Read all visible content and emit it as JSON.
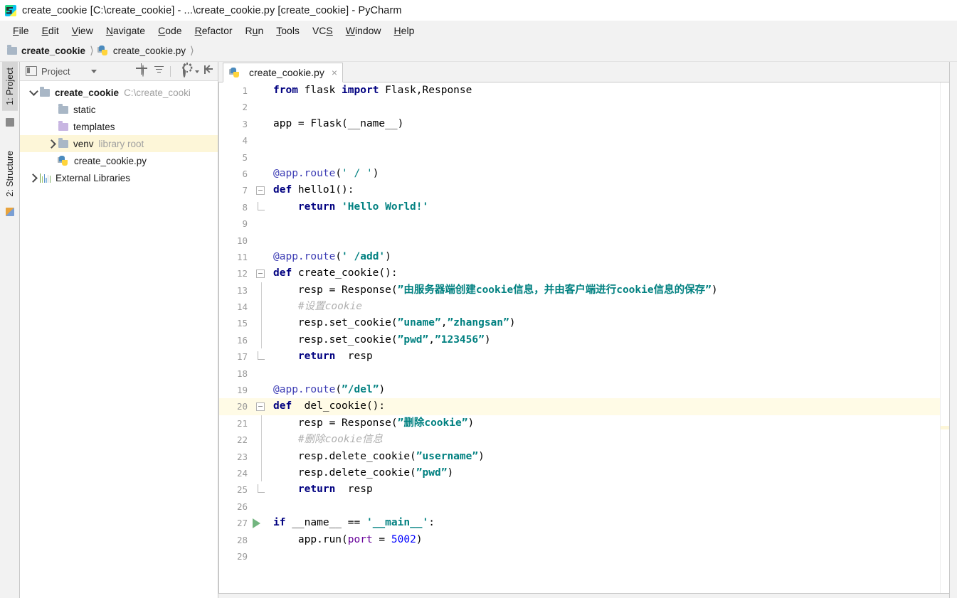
{
  "window": {
    "title": "create_cookie [C:\\create_cookie] - ...\\create_cookie.py [create_cookie] - PyCharm",
    "app_icon": "pycharm-icon"
  },
  "menubar": {
    "items": [
      {
        "label": "File",
        "mnemonic": "F"
      },
      {
        "label": "Edit",
        "mnemonic": "E"
      },
      {
        "label": "View",
        "mnemonic": "V"
      },
      {
        "label": "Navigate",
        "mnemonic": "N"
      },
      {
        "label": "Code",
        "mnemonic": "C"
      },
      {
        "label": "Refactor",
        "mnemonic": "R"
      },
      {
        "label": "Run",
        "mnemonic": "u"
      },
      {
        "label": "Tools",
        "mnemonic": "T"
      },
      {
        "label": "VCS",
        "mnemonic": "S"
      },
      {
        "label": "Window",
        "mnemonic": "W"
      },
      {
        "label": "Help",
        "mnemonic": "H"
      }
    ]
  },
  "breadcrumb": {
    "items": [
      {
        "label": "create_cookie",
        "icon": "folder-icon",
        "bold": true
      },
      {
        "label": "create_cookie.py",
        "icon": "python-file-icon",
        "bold": false
      }
    ]
  },
  "tool_windows": {
    "left_tabs": [
      {
        "label": "1: Project",
        "active": true,
        "icon": "project-icon"
      },
      {
        "label": "2: Structure",
        "active": false,
        "icon": "structure-icon"
      }
    ]
  },
  "project_panel": {
    "title": "Project",
    "toolbar_icons": [
      {
        "name": "locate-icon",
        "title": "Select Opened File"
      },
      {
        "name": "collapse-all-icon",
        "title": "Collapse All"
      },
      {
        "name": "gear-icon",
        "title": "Settings"
      },
      {
        "name": "hide-icon",
        "title": "Hide"
      }
    ],
    "tree": [
      {
        "label": "create_cookie",
        "sub": "C:\\create_cooki",
        "icon": "folder-icon",
        "indent": 0,
        "arrow": "down",
        "bold": true,
        "highlight": false
      },
      {
        "label": "static",
        "sub": "",
        "icon": "folder-icon",
        "indent": 1,
        "arrow": "none",
        "bold": false,
        "highlight": false
      },
      {
        "label": "templates",
        "sub": "",
        "icon": "folder-purple-icon",
        "indent": 1,
        "arrow": "none",
        "bold": false,
        "highlight": false
      },
      {
        "label": "venv",
        "sub": "library root",
        "icon": "folder-icon",
        "indent": 1,
        "arrow": "right",
        "bold": false,
        "highlight": true
      },
      {
        "label": "create_cookie.py",
        "sub": "",
        "icon": "python-file-icon",
        "indent": 1,
        "arrow": "none",
        "bold": false,
        "highlight": false
      },
      {
        "label": "External Libraries",
        "sub": "",
        "icon": "libraries-icon",
        "indent": 0,
        "arrow": "right",
        "bold": false,
        "highlight": false
      }
    ]
  },
  "editor": {
    "tabs": [
      {
        "label": "create_cookie.py",
        "icon": "python-file-icon",
        "active": true,
        "close_glyph": "×"
      }
    ],
    "highlighted_line": 20,
    "run_marker_line": 27,
    "lines": [
      {
        "n": 1,
        "tokens": [
          {
            "t": "from ",
            "c": "kw"
          },
          {
            "t": "flask ",
            "c": "fn"
          },
          {
            "t": "import ",
            "c": "kw"
          },
          {
            "t": "Flask,Response",
            "c": "fn"
          }
        ]
      },
      {
        "n": 2,
        "tokens": []
      },
      {
        "n": 3,
        "tokens": [
          {
            "t": "app = Flask(",
            "c": "fn"
          },
          {
            "t": "__name__",
            "c": "fn"
          },
          {
            "t": ")",
            "c": "fn"
          }
        ]
      },
      {
        "n": 4,
        "tokens": []
      },
      {
        "n": 5,
        "tokens": []
      },
      {
        "n": 6,
        "tokens": [
          {
            "t": "@app.route",
            "c": "deco"
          },
          {
            "t": "(",
            "c": "fn"
          },
          {
            "t": "' / '",
            "c": "str-plain"
          },
          {
            "t": ")",
            "c": "fn"
          }
        ]
      },
      {
        "n": 7,
        "tokens": [
          {
            "t": "def ",
            "c": "kw"
          },
          {
            "t": "hello1():",
            "c": "fn"
          }
        ]
      },
      {
        "n": 8,
        "tokens": [
          {
            "t": "    ",
            "c": "fn"
          },
          {
            "t": "return ",
            "c": "kw"
          },
          {
            "t": "'Hello World!'",
            "c": "str"
          }
        ]
      },
      {
        "n": 9,
        "tokens": []
      },
      {
        "n": 10,
        "tokens": []
      },
      {
        "n": 11,
        "tokens": [
          {
            "t": "@app.route",
            "c": "deco"
          },
          {
            "t": "(",
            "c": "fn"
          },
          {
            "t": "' /add'",
            "c": "str"
          },
          {
            "t": ")",
            "c": "fn"
          }
        ]
      },
      {
        "n": 12,
        "tokens": [
          {
            "t": "def ",
            "c": "kw"
          },
          {
            "t": "create_cookie():",
            "c": "fn"
          }
        ]
      },
      {
        "n": 13,
        "tokens": [
          {
            "t": "    resp = Response(",
            "c": "fn"
          },
          {
            "t": "”由服务器端创建cookie信息，并由客户端进行cookie信息的保存”",
            "c": "str"
          },
          {
            "t": ")",
            "c": "fn"
          }
        ]
      },
      {
        "n": 14,
        "tokens": [
          {
            "t": "    #设置cookie",
            "c": "cmt"
          }
        ]
      },
      {
        "n": 15,
        "tokens": [
          {
            "t": "    resp.set_cookie(",
            "c": "fn"
          },
          {
            "t": "”uname”",
            "c": "str"
          },
          {
            "t": ",",
            "c": "fn"
          },
          {
            "t": "”zhangsan”",
            "c": "str"
          },
          {
            "t": ")",
            "c": "fn"
          }
        ]
      },
      {
        "n": 16,
        "tokens": [
          {
            "t": "    resp.set_cookie(",
            "c": "fn"
          },
          {
            "t": "”pwd”",
            "c": "str"
          },
          {
            "t": ",",
            "c": "fn"
          },
          {
            "t": "”123456”",
            "c": "str"
          },
          {
            "t": ")",
            "c": "fn"
          }
        ]
      },
      {
        "n": 17,
        "tokens": [
          {
            "t": "    ",
            "c": "fn"
          },
          {
            "t": "return ",
            "c": "kw"
          },
          {
            "t": " resp",
            "c": "fn"
          }
        ]
      },
      {
        "n": 18,
        "tokens": []
      },
      {
        "n": 19,
        "tokens": [
          {
            "t": "@app.route",
            "c": "deco"
          },
          {
            "t": "(",
            "c": "fn"
          },
          {
            "t": "”/del”",
            "c": "str"
          },
          {
            "t": ")",
            "c": "fn"
          }
        ]
      },
      {
        "n": 20,
        "tokens": [
          {
            "t": "def ",
            "c": "kw"
          },
          {
            "t": " del_cookie():",
            "c": "fn"
          }
        ]
      },
      {
        "n": 21,
        "tokens": [
          {
            "t": "    resp = Response(",
            "c": "fn"
          },
          {
            "t": "”删除cookie”",
            "c": "str"
          },
          {
            "t": ")",
            "c": "fn"
          }
        ]
      },
      {
        "n": 22,
        "tokens": [
          {
            "t": "    #删除cookie信息",
            "c": "cmt"
          }
        ]
      },
      {
        "n": 23,
        "tokens": [
          {
            "t": "    resp.delete_cookie(",
            "c": "fn"
          },
          {
            "t": "”username”",
            "c": "str"
          },
          {
            "t": ")",
            "c": "fn"
          }
        ]
      },
      {
        "n": 24,
        "tokens": [
          {
            "t": "    resp.delete_cookie(",
            "c": "fn"
          },
          {
            "t": "”pwd”",
            "c": "str"
          },
          {
            "t": ")",
            "c": "fn"
          }
        ]
      },
      {
        "n": 25,
        "tokens": [
          {
            "t": "    ",
            "c": "fn"
          },
          {
            "t": "return ",
            "c": "kw"
          },
          {
            "t": " resp",
            "c": "fn"
          }
        ]
      },
      {
        "n": 26,
        "tokens": []
      },
      {
        "n": 27,
        "tokens": [
          {
            "t": "if ",
            "c": "kw"
          },
          {
            "t": "__name__ == ",
            "c": "fn"
          },
          {
            "t": "'__main__'",
            "c": "str"
          },
          {
            "t": ":",
            "c": "fn"
          }
        ]
      },
      {
        "n": 28,
        "tokens": [
          {
            "t": "    app.run(",
            "c": "fn"
          },
          {
            "t": "port",
            "c": "param"
          },
          {
            "t": " = ",
            "c": "fn"
          },
          {
            "t": "5002",
            "c": "num"
          },
          {
            "t": ")",
            "c": "fn"
          }
        ]
      },
      {
        "n": 29,
        "tokens": []
      }
    ],
    "fold_markers": [
      {
        "line": 7,
        "type": "start"
      },
      {
        "line": 8,
        "type": "end"
      },
      {
        "line": 12,
        "type": "start"
      },
      {
        "line": 17,
        "type": "end"
      },
      {
        "line": 20,
        "type": "start"
      },
      {
        "line": 25,
        "type": "end"
      }
    ]
  },
  "colors": {
    "keyword": "#000080",
    "string": "#008080",
    "decorator": "#3e3eb5",
    "comment": "#b0b0b0",
    "number": "#0000ff",
    "parameter": "#660099",
    "highlight_line": "#fffbe6",
    "tree_highlight": "#fdf6d8",
    "run_arrow": "#59a869"
  }
}
